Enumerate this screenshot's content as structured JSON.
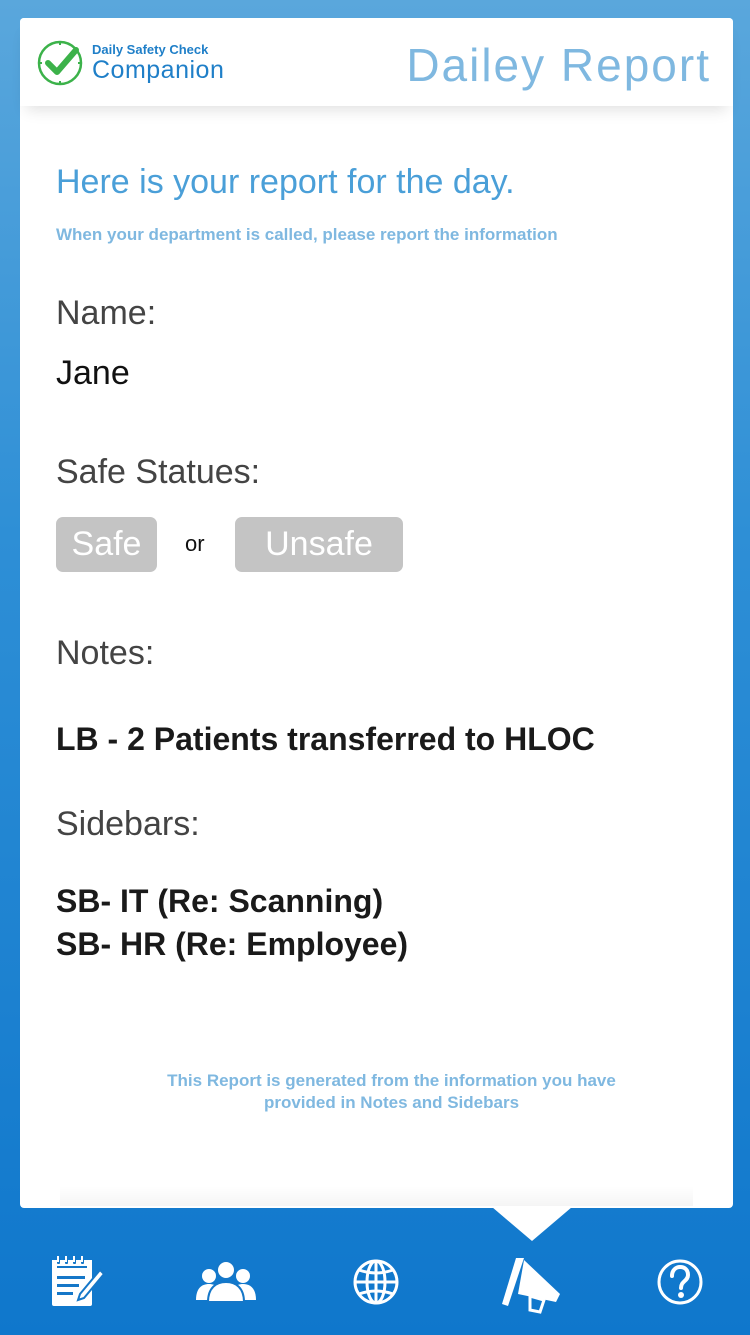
{
  "header": {
    "logo_small": "Daily Safety Check",
    "logo_big": "Companion",
    "title": "Dailey Report"
  },
  "report": {
    "intro": "Here is your report for the day.",
    "sub": "When your department is called, please report the information",
    "name_label": "Name:",
    "name_value": "Jane",
    "status_label": "Safe Statues:",
    "safe_label": "Safe",
    "or_label": "or",
    "unsafe_label": "Unsafe",
    "notes_label": "Notes:",
    "notes_value": "LB - 2 Patients transferred to HLOC",
    "sidebars_label": "Sidebars:",
    "sidebars": [
      "SB- IT (Re: Scanning)",
      "SB- HR (Re: Employee)"
    ],
    "footer_line1": "This Report is generated from the information you have",
    "footer_line2": "provided in Notes and Sidebars"
  },
  "nav": {
    "items": [
      "notes-icon",
      "people-icon",
      "globe-icon",
      "megaphone-icon",
      "help-icon"
    ],
    "active": "megaphone-icon"
  },
  "colors": {
    "accent": "#1f7fc8",
    "title": "#7fb8e0",
    "button": "#c4c4c4",
    "check_green": "#3cb24a"
  }
}
